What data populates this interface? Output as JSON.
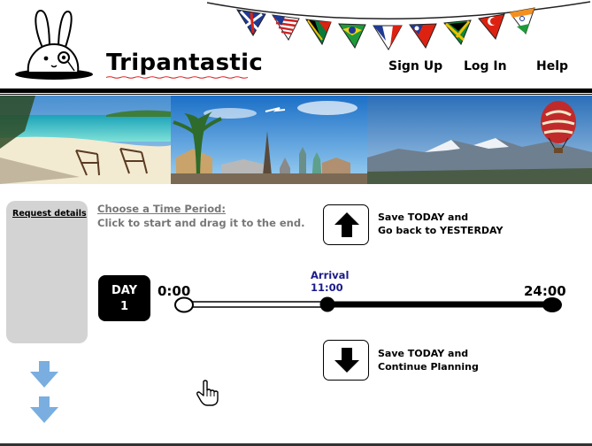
{
  "app": {
    "name": "Tripantastic"
  },
  "nav": {
    "sign_up": "Sign Up",
    "log_in": "Log In",
    "help": "Help"
  },
  "sidebar": {
    "request_details": "Request details"
  },
  "instructions": {
    "title": "Choose a Time Period:",
    "text": "Click to start and drag it to the end."
  },
  "actions": {
    "back": {
      "line1": "Save TODAY and",
      "line2": "Go back to YESTERDAY",
      "icon": "arrow-up-icon"
    },
    "forward": {
      "line1": "Save TODAY and",
      "line2": "Continue Planning",
      "icon": "arrow-down-icon"
    }
  },
  "timeline": {
    "day_label": "DAY",
    "day_number": "1",
    "start_time": "0:00",
    "end_time": "24:00",
    "arrival_label": "Arrival",
    "arrival_time": "11:00"
  },
  "colors": {
    "arrival_text": "#1a1a8c",
    "sidebar_bg": "#d3d3d3",
    "sidebar_arrows": "#7aaee0",
    "instruction_text": "#777777"
  }
}
